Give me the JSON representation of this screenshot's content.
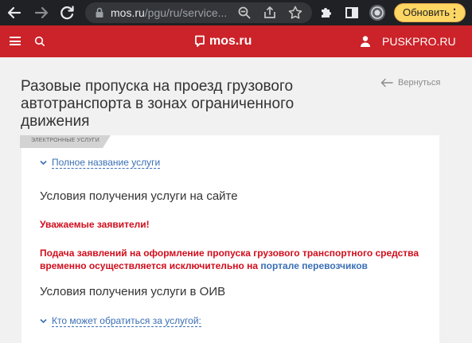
{
  "browser": {
    "url_domain": "mos.ru",
    "url_path": "/pgu/ru/service...",
    "update_button": "Обновить"
  },
  "site_header": {
    "logo": "mos.ru",
    "user_name": "PUSKPRO.RU"
  },
  "page": {
    "title": "Разовые пропуска на проезд грузового автотранспорта в зонах ограниченного движения",
    "back_link": "Вернуться",
    "tag": "ЭЛЕКТРОННЫЕ УСЛУГИ",
    "full_name_toggle": "Полное название услуги",
    "section_site": "Условия получения услуги на сайте",
    "notice_heading": "Уважаемые заявители!",
    "notice_body": "Подача заявлений на оформление пропуска грузового транспортного средства временно осуществляется исключительно на",
    "notice_link": "портале перевозчиков",
    "section_oiv": "Условия получения услуги в ОИВ",
    "who_toggle": "Кто может обратиться за услугой:"
  },
  "colors": {
    "brand_red": "#cc2229",
    "link_blue": "#3a6fb5",
    "notice_red": "#d10d1c",
    "update_yellow": "#fdd663"
  }
}
